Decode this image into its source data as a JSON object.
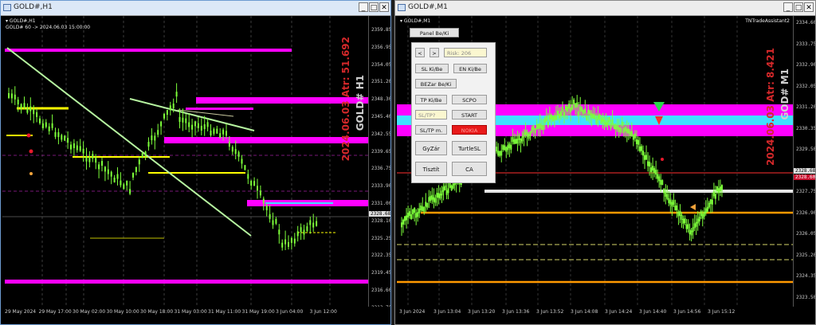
{
  "windows": {
    "left": {
      "title": "GOLD#,H1",
      "header_symbol": "GOLD#,H1",
      "header_info": "GOLD# 60 -> 2024.06.03 15:00:00",
      "watermark_symbol": "GOLD# H1",
      "watermark_info": "2024.06.03 Atr: 51.692",
      "price_labels": [
        "2359.85",
        "2356.95",
        "2354.05",
        "2351.20",
        "2348.30",
        "2345.40",
        "2342.55",
        "2339.65",
        "2336.75",
        "2333.90",
        "2331.00",
        "2328.10",
        "2325.25",
        "2322.35",
        "2319.45",
        "2316.60",
        "2313.70"
      ],
      "current_price": "2328.68",
      "time_labels": [
        "29 May 2024",
        "29 May 17:00",
        "30 May 02:00",
        "30 May 10:00",
        "30 May 18:00",
        "31 May 03:00",
        "31 May 11:00",
        "31 May 19:00",
        "3 Jun 04:00",
        "3 Jun 12:00"
      ]
    },
    "right": {
      "title": "GOLD#,M1",
      "header_symbol": "GOLD#,M1",
      "ea_label": "TNTradeAssistant2",
      "watermark_symbol": "GOD# M1",
      "watermark_info": "2024.06.03 Atr: 8.421",
      "price_labels": [
        "2334.60",
        "2333.75",
        "2332.90",
        "2332.05",
        "2331.20",
        "2330.35",
        "2329.50",
        "2328.60",
        "2327.75",
        "2326.90",
        "2326.05",
        "2325.20",
        "2324.35",
        "2323.50"
      ],
      "current_tags": [
        "2328.68",
        "2328.60"
      ],
      "time_labels": [
        "3 Jun 2024",
        "3 Jun 13:04",
        "3 Jun 13:20",
        "3 Jun 13:36",
        "3 Jun 13:52",
        "3 Jun 14:08",
        "3 Jun 14:24",
        "3 Jun 14:40",
        "3 Jun 14:56",
        "3 Jun 15:12"
      ]
    }
  },
  "window_buttons": {
    "minimize": "_",
    "maximize": "□",
    "close": "✕"
  },
  "panel": {
    "toggle": "Panel Be/Ki",
    "prev": "<",
    "next": ">",
    "risk_placeholder": "Risk: 206",
    "sl": "SL Ki/Be",
    "en": "EN Ki/Be",
    "bezar": "BEZar Be/Ki",
    "tp": "TP Ki/Be",
    "scpo": "SCPO",
    "sltp": "SL/TP?",
    "start": "START",
    "sltp_m": "SL/TP m.",
    "nokia": "NOKIA",
    "gyzar": "GyZár",
    "turtle": "TurtleSL",
    "tisztit": "Tisztít",
    "ca": "CA"
  },
  "colors": {
    "bull": "#7dff3a",
    "magenta": "#ff00ff",
    "yellow": "#ffff00",
    "orange": "#ff9900",
    "cyan": "#40e0ff",
    "red": "#e8192c"
  }
}
